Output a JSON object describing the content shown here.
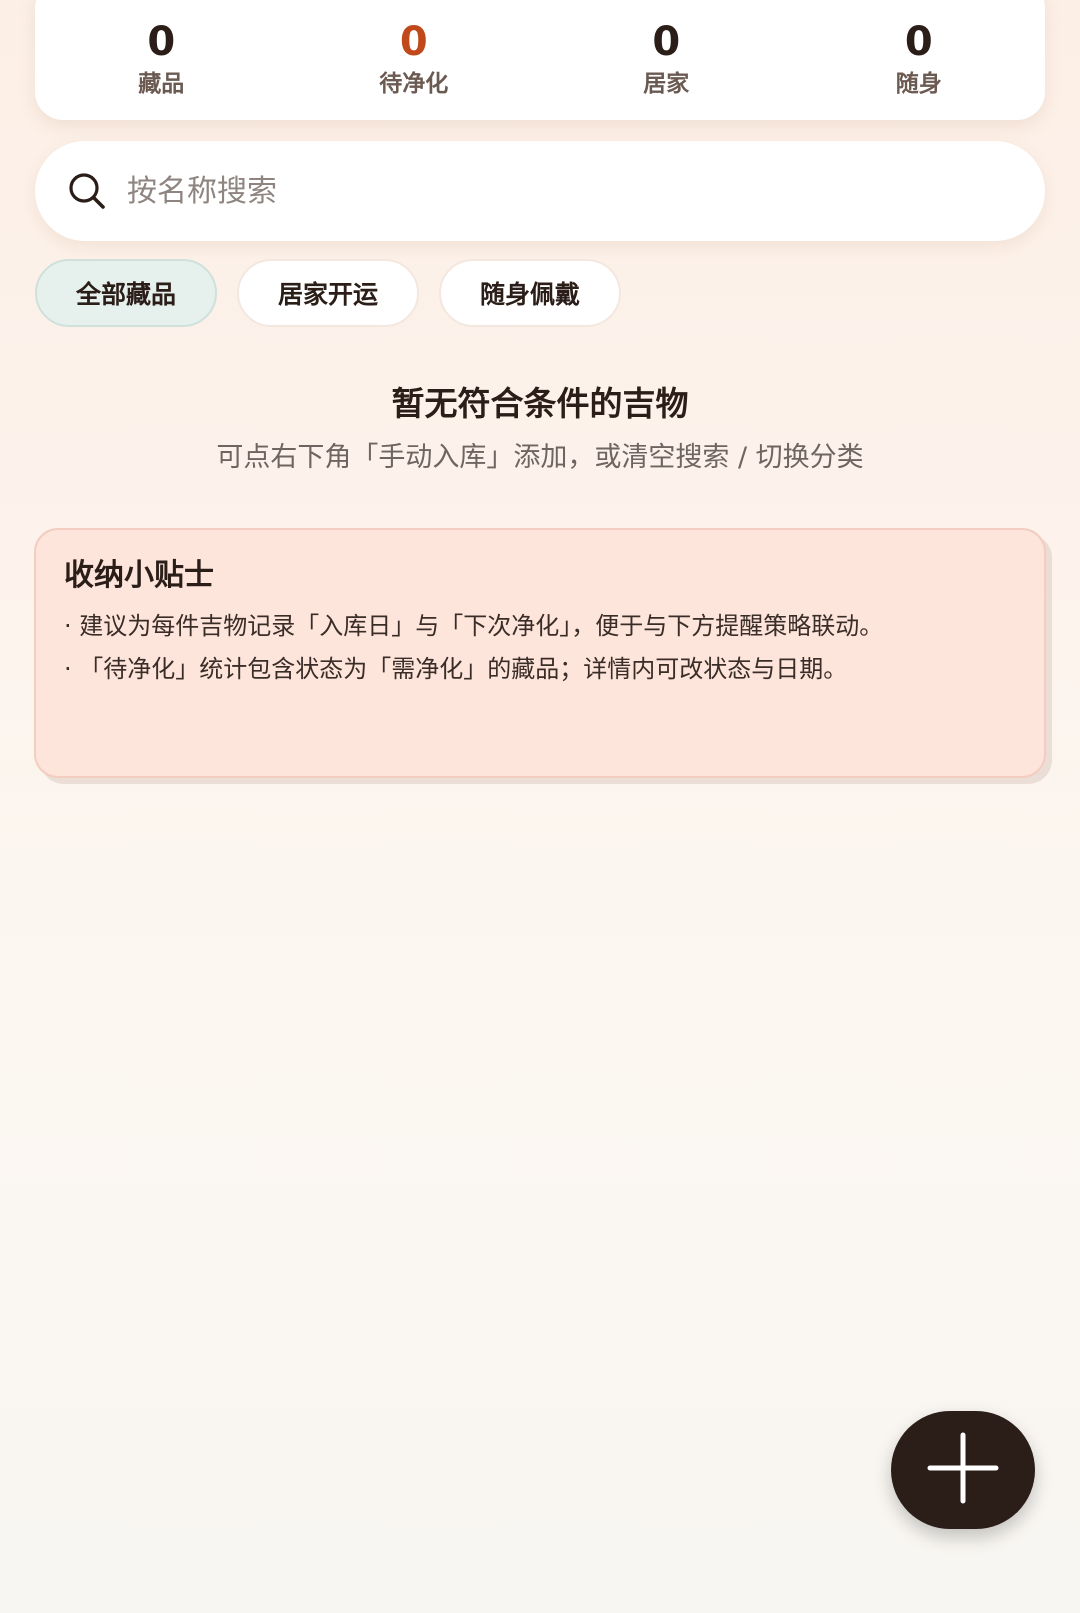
{
  "stats": [
    {
      "value": "0",
      "label": "藏品",
      "accent": false
    },
    {
      "value": "0",
      "label": "待净化",
      "accent": true
    },
    {
      "value": "0",
      "label": "居家",
      "accent": false
    },
    {
      "value": "0",
      "label": "随身",
      "accent": false
    }
  ],
  "search": {
    "placeholder": "按名称搜索",
    "value": "",
    "icon": "search-icon"
  },
  "filters": [
    {
      "label": "全部藏品",
      "active": true
    },
    {
      "label": "居家开运",
      "active": false
    },
    {
      "label": "随身佩戴",
      "active": false
    }
  ],
  "empty_state": {
    "title": "暂无符合条件的吉物",
    "subtitle": "可点右下角「手动入库」添加，或清空搜索 / 切换分类"
  },
  "tips": {
    "title": "收纳小贴士",
    "items": [
      "· 建议为每件吉物记录「入库日」与「下次净化」，便于与下方提醒策略联动。",
      "· 「待净化」统计包含状态为「需净化」的藏品；详情内可改状态与日期。"
    ]
  },
  "fab": {
    "icon": "plus-icon"
  },
  "colors": {
    "accent": "#c0481a",
    "fab": "#2b1d17",
    "tips_bg": "#fde5dc",
    "chip_active_bg": "#e6f0ec"
  }
}
